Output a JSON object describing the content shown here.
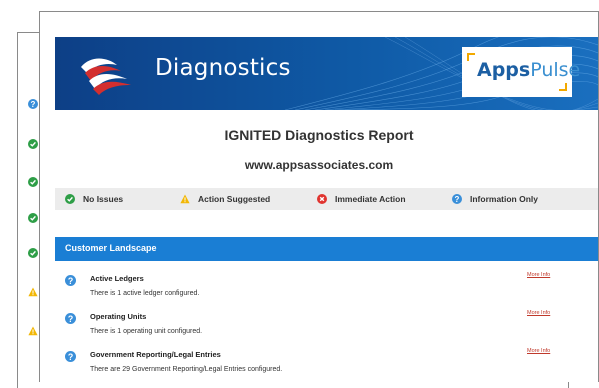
{
  "banner": {
    "title": "Diagnostics",
    "brand_prefix": "Apps",
    "brand_suffix": "Pulse"
  },
  "report": {
    "title": "IGNITED Diagnostics Report",
    "url": "www.appsassociates.com"
  },
  "legend": [
    {
      "label": "No Issues",
      "icon": "check-icon",
      "color": "#2e9e47"
    },
    {
      "label": "Action Suggested",
      "icon": "warning-icon",
      "color": "#f2b705"
    },
    {
      "label": "Immediate Action",
      "icon": "error-icon",
      "color": "#e0342f"
    },
    {
      "label": "Information Only",
      "icon": "info-icon",
      "color": "#3a8fd9"
    }
  ],
  "section": {
    "title": "Customer Landscape",
    "items": [
      {
        "title": "Active Ledgers",
        "description": "There is 1 active ledger configured.",
        "link": "More Info"
      },
      {
        "title": "Operating Units",
        "description": "There is 1 operating unit configured.",
        "link": "More Info"
      },
      {
        "title": "Government Reporting/Legal Entries",
        "description": "There are 29 Government Reporting/Legal Entries configured.",
        "link": "More Info"
      }
    ]
  },
  "status_column": [
    "info-icon",
    "check-icon",
    "check-icon",
    "check-icon",
    "check-icon",
    "warning-icon",
    "warning-icon"
  ]
}
